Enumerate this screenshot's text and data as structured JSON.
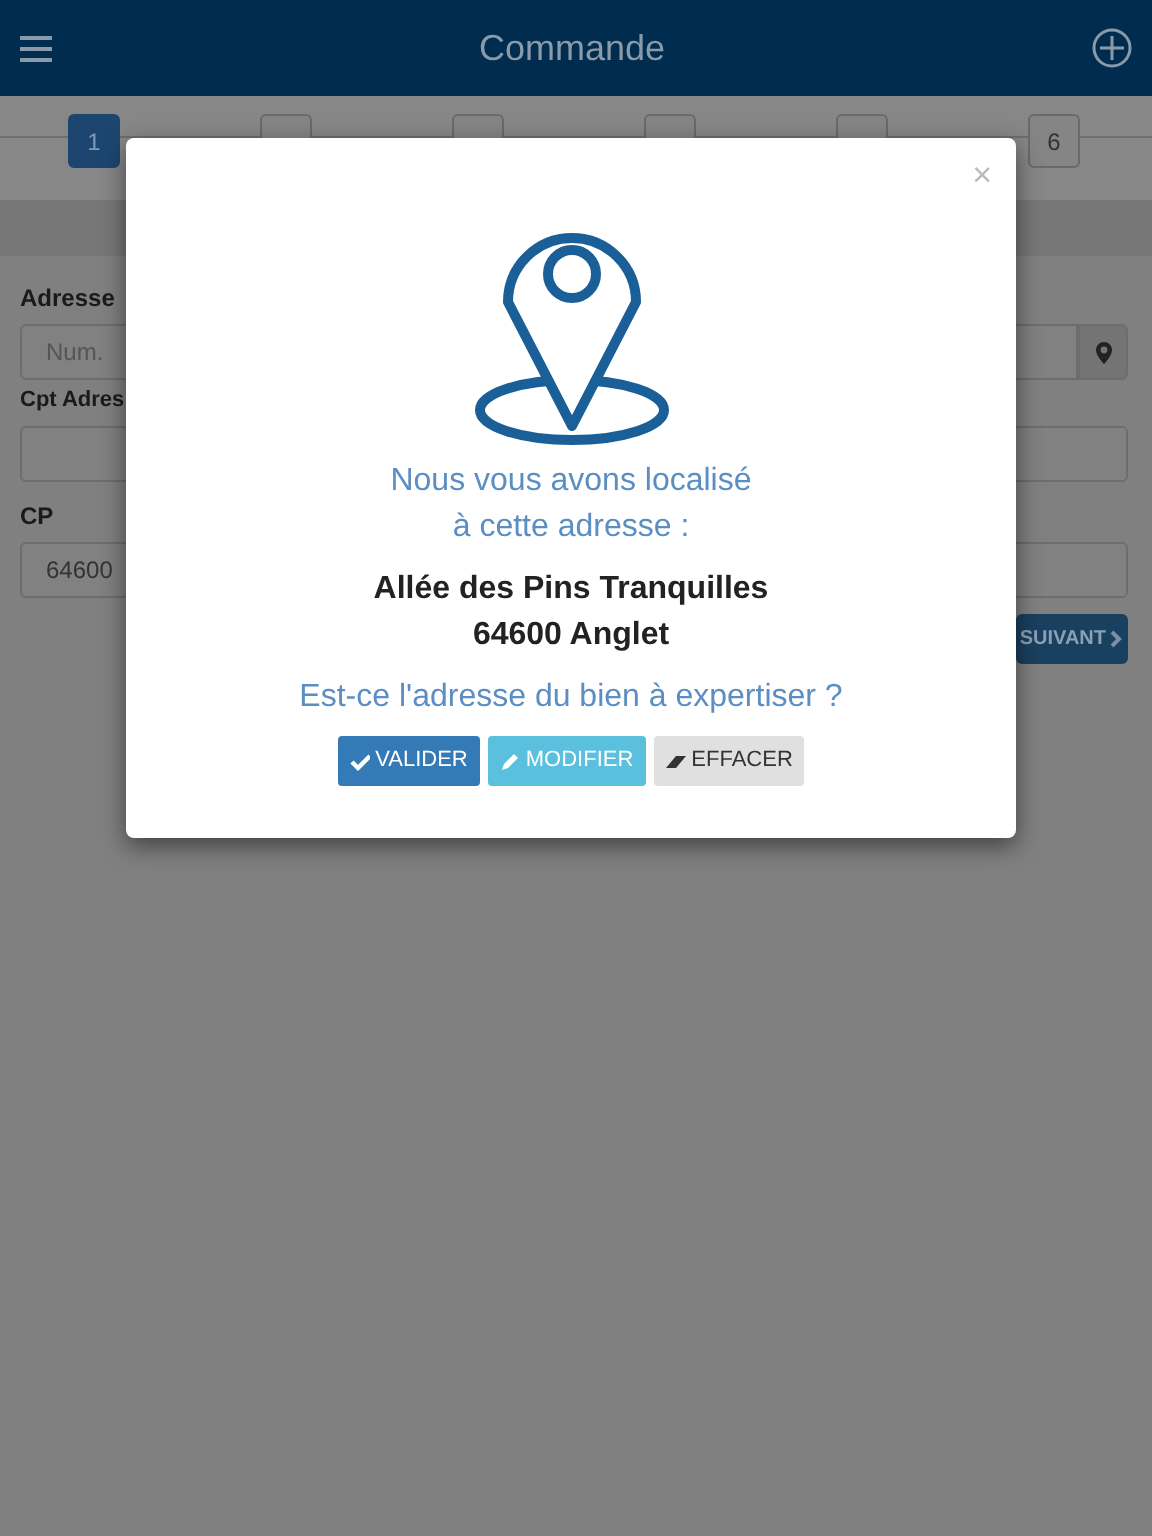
{
  "header": {
    "title": "Commande"
  },
  "steps": [
    {
      "label": "1",
      "selected": true
    },
    {
      "selected": false
    },
    {
      "selected": false
    },
    {
      "selected": false
    },
    {
      "selected": false
    },
    {
      "label": "6",
      "selected": false
    }
  ],
  "form": {
    "address_label": "Adresse",
    "number_placeholder": "Num.",
    "complement_label": "Cpt Adres",
    "postcode_label": "CP",
    "postcode_value": "64600",
    "next_button": "SUIVANT"
  },
  "modal": {
    "close": "×",
    "message_lines": [
      "Nous vous avons localisé",
      "à cette adresse :"
    ],
    "address_lines": [
      "Allée des Pins Tranquilles",
      "64600 Anglet"
    ],
    "question": "Est-ce l'adresse du bien à expertiser ?",
    "buttons": [
      {
        "kind": "validate",
        "label": "VALIDER"
      },
      {
        "kind": "modify",
        "label": "MODIFIER"
      },
      {
        "kind": "erase",
        "label": "EFFACER"
      }
    ]
  }
}
